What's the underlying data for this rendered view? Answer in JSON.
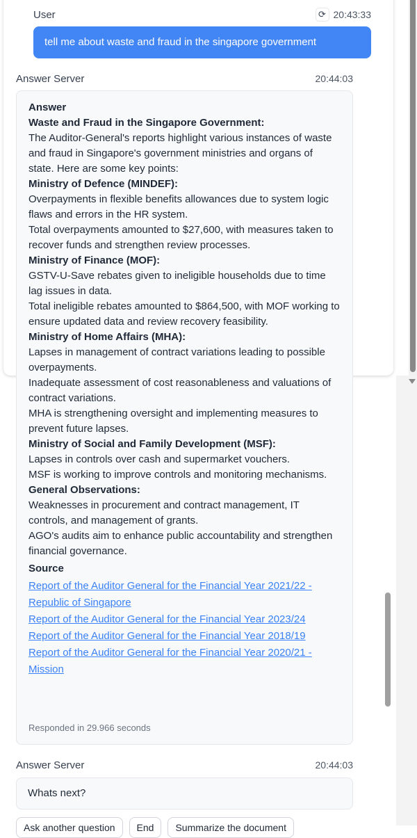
{
  "user_message": {
    "sender": "User",
    "time": "20:43:33",
    "text": "tell me about waste and fraud in the singapore government"
  },
  "answer_message": {
    "sender": "Answer Server",
    "time": "20:44:03",
    "heading": "Answer",
    "blocks": [
      {
        "type": "bold",
        "text": "Waste and Fraud in the Singapore Government:"
      },
      {
        "type": "text",
        "text": "The Auditor-General's reports highlight various instances of waste and fraud in Singapore's government ministries and organs of state. Here are some key points:"
      },
      {
        "type": "bold",
        "text": "Ministry of Defence (MINDEF):"
      },
      {
        "type": "text",
        "text": "Overpayments in flexible benefits allowances due to system logic flaws and errors in the HR system."
      },
      {
        "type": "text",
        "text": "Total overpayments amounted to $27,600, with measures taken to recover funds and strengthen review processes."
      },
      {
        "type": "bold",
        "text": "Ministry of Finance (MOF):"
      },
      {
        "type": "text",
        "text": "GSTV-U-Save rebates given to ineligible households due to time lag issues in data."
      },
      {
        "type": "text",
        "text": "Total ineligible rebates amounted to $864,500, with MOF working to ensure updated data and review recovery feasibility."
      },
      {
        "type": "bold",
        "text": "Ministry of Home Affairs (MHA):"
      },
      {
        "type": "text",
        "text": "Lapses in management of contract variations leading to possible overpayments."
      },
      {
        "type": "text",
        "text": "Inadequate assessment of cost reasonableness and valuations of contract variations."
      },
      {
        "type": "text",
        "text": "MHA is strengthening oversight and implementing measures to prevent future lapses."
      },
      {
        "type": "bold",
        "text": "Ministry of Social and Family Development (MSF):"
      },
      {
        "type": "text",
        "text": "Lapses in controls over cash and supermarket vouchers."
      },
      {
        "type": "text",
        "text": "MSF is working to improve controls and monitoring mechanisms."
      },
      {
        "type": "bold",
        "text": "General Observations:"
      },
      {
        "type": "text",
        "text": "Weaknesses in procurement and contract management, IT controls, and management of grants."
      },
      {
        "type": "text",
        "text": "AGO's audits aim to enhance public accountability and strengthen financial governance."
      }
    ],
    "source_heading": "Source",
    "sources": [
      "Report of the Auditor General for the Financial Year 2021/22 - Republic of Singapore",
      "Report of the Auditor General for the Financial Year 2023/24",
      "Report of the Auditor General for the Financial Year 2018/19",
      "Report of the Auditor General for the Financial Year 2020/21 - Mission"
    ],
    "responded": "Responded in 29.966 seconds"
  },
  "next_message": {
    "sender": "Answer Server",
    "time": "20:44:03",
    "text": "Whats next?"
  },
  "chips": [
    "Ask another question",
    "End",
    "Summarize the document"
  ]
}
